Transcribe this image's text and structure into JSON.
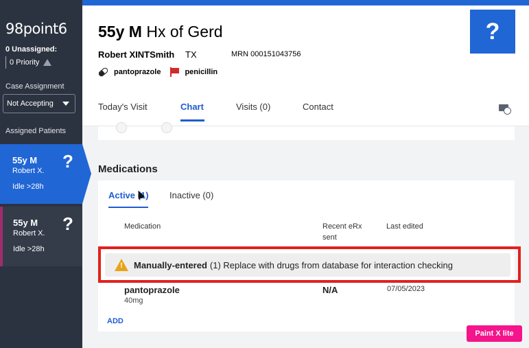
{
  "sidebar": {
    "logo": "98point6",
    "unassigned": "0 Unassigned:",
    "priority": "0 Priority",
    "case_assignment_label": "Case Assignment",
    "case_assignment_value": "Not Accepting",
    "assigned_patients_label": "Assigned Patients",
    "patients": [
      {
        "age_sex": "55y M",
        "name": "Robert X.",
        "status": "Idle >28h",
        "flag": "?"
      },
      {
        "age_sex": "55y M",
        "name": "Robert X.",
        "status": "Idle >28h",
        "flag": "?"
      }
    ]
  },
  "header": {
    "title_bold": "55y M",
    "title_rest": " Hx of Gerd",
    "patient_name": "Robert XINTSmith",
    "state": "TX",
    "mrn": "MRN 000151043756",
    "medication_tag": "pantoprazole",
    "allergy_tag": "penicillin",
    "help_symbol": "?"
  },
  "tabs": [
    {
      "label": "Today's Visit"
    },
    {
      "label": "Chart"
    },
    {
      "label": "Visits (0)"
    },
    {
      "label": "Contact"
    }
  ],
  "medications": {
    "heading": "Medications",
    "active_tab": "Active (1)",
    "inactive_tab": "Inactive (0)",
    "columns": {
      "medication": "Medication",
      "recent_erx": "Recent eRx sent",
      "last_edited": "Last edited"
    },
    "warning": {
      "bold": "Manually-entered",
      "text": "(1) Replace with drugs from database for interaction checking"
    },
    "rows": [
      {
        "name": "pantoprazole",
        "dose": "40mg",
        "erx": "N/A",
        "last_edited": "07/05/2023"
      }
    ],
    "add_label": "ADD"
  },
  "watermark": "Paint X lite"
}
